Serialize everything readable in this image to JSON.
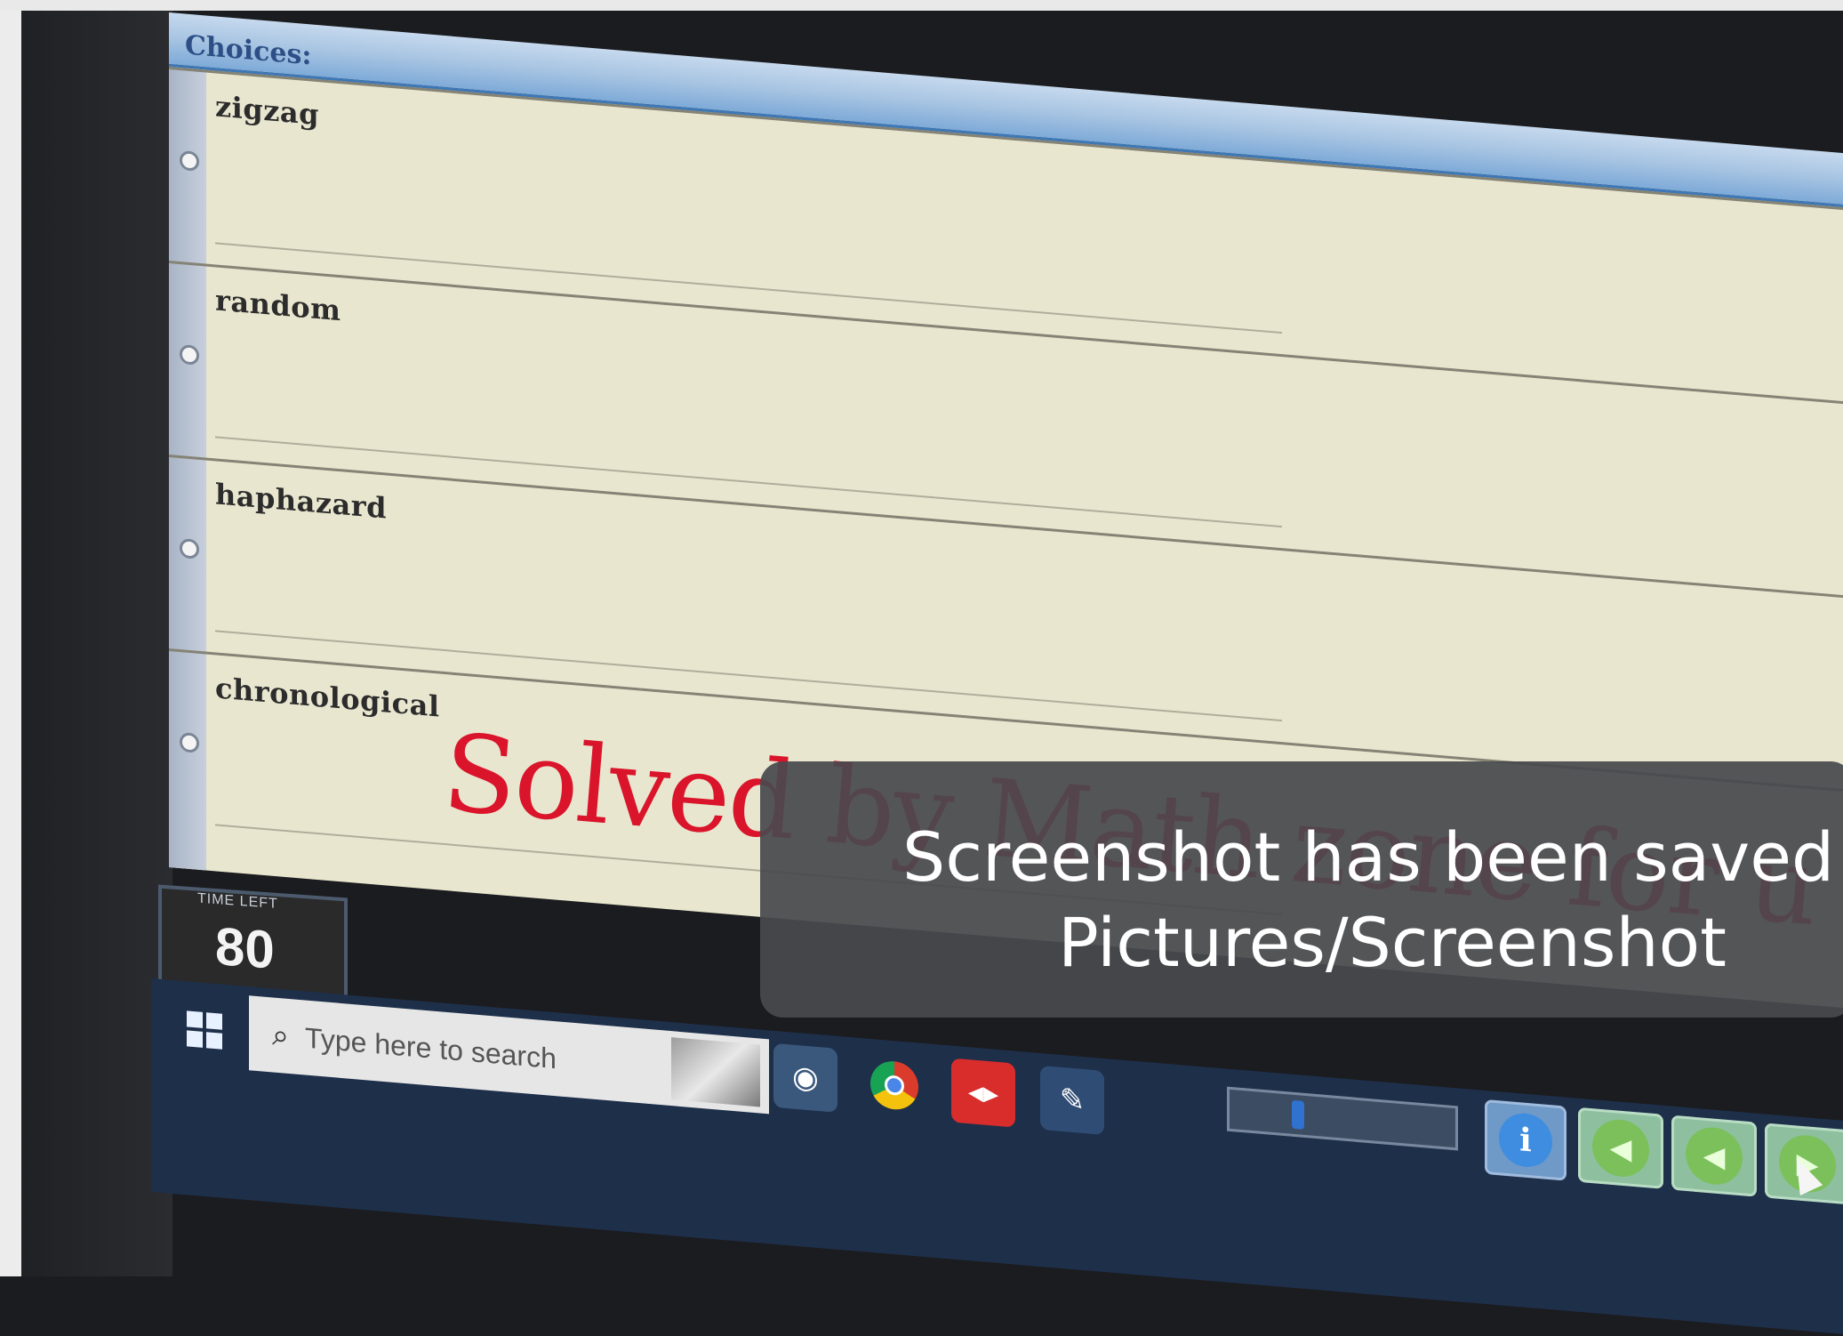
{
  "choices": {
    "title": "Choices:",
    "items": [
      {
        "label": "zigzag"
      },
      {
        "label": "random"
      },
      {
        "label": "haphazard"
      },
      {
        "label": "chronological"
      }
    ]
  },
  "watermark": {
    "text": "Solved by Math zone for u"
  },
  "timer": {
    "label": "TIME LEFT",
    "value": "80"
  },
  "taskbar": {
    "search_placeholder": "Type here to search",
    "icons": [
      "windows-icon",
      "camera-icon",
      "chrome-icon",
      "app-red-icon",
      "eraser-icon"
    ]
  },
  "controls": {
    "info_label": "i",
    "first_label": "◀",
    "prev_label": "◀",
    "next_label": "▶"
  },
  "toast": {
    "line1": "Screenshot has been saved to",
    "line2": "Pictures/Screenshot"
  },
  "colors": {
    "header_blue": "#7eaad8",
    "list_bg": "#e9e6cf",
    "watermark_red": "#d9142b",
    "toast_bg": "#48494d",
    "taskbar": "#1e2f4a"
  }
}
